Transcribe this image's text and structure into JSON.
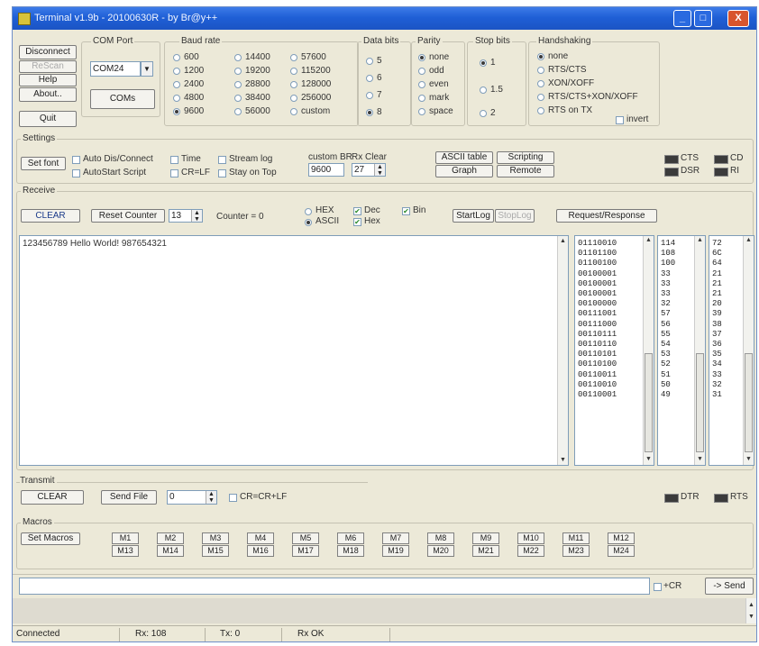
{
  "window": {
    "title": "Terminal v1.9b - 20100630R - by Br@y++",
    "minimize": "_",
    "maximize": "□",
    "close": "X"
  },
  "left_buttons": {
    "disconnect": "Disconnect",
    "rescan": "ReScan",
    "help": "Help",
    "about": "About..",
    "quit": "Quit"
  },
  "com_port": {
    "label": "COM Port",
    "value": "COM24",
    "coms_button": "COMs"
  },
  "baud_rate": {
    "label": "Baud rate",
    "options": [
      "600",
      "1200",
      "2400",
      "4800",
      "9600",
      "14400",
      "19200",
      "28800",
      "38400",
      "56000",
      "57600",
      "115200",
      "128000",
      "256000",
      "custom"
    ],
    "selected": "9600"
  },
  "data_bits": {
    "label": "Data bits",
    "options": [
      "5",
      "6",
      "7",
      "8"
    ],
    "selected": "8"
  },
  "parity": {
    "label": "Parity",
    "options": [
      "none",
      "odd",
      "even",
      "mark",
      "space"
    ],
    "selected": "none"
  },
  "stop_bits": {
    "label": "Stop bits",
    "options": [
      "1",
      "1.5",
      "2"
    ],
    "selected": "1"
  },
  "handshaking": {
    "label": "Handshaking",
    "options": [
      "none",
      "RTS/CTS",
      "XON/XOFF",
      "RTS/CTS+XON/XOFF",
      "RTS on TX"
    ],
    "selected": "none",
    "invert_label": "invert"
  },
  "settings": {
    "label": "Settings",
    "set_font": "Set font",
    "auto_dis_connect": "Auto Dis/Connect",
    "autostart_script": "AutoStart Script",
    "time": "Time",
    "cr_lf": "CR=LF",
    "stream_log": "Stream log",
    "stay_on_top": "Stay on Top",
    "custom_br_label": "custom BR",
    "custom_br_value": "9600",
    "rx_clear_label": "Rx Clear",
    "rx_clear_value": "27",
    "ascii_table": "ASCII table",
    "graph": "Graph",
    "scripting": "Scripting",
    "remote": "Remote",
    "leds": {
      "cts": "CTS",
      "cd": "CD",
      "dsr": "DSR",
      "ri": "RI"
    }
  },
  "receive": {
    "label": "Receive",
    "clear": "CLEAR",
    "reset_counter": "Reset Counter",
    "counter_spin": "13",
    "counter_text": "Counter = 0",
    "hex": "HEX",
    "ascii": "ASCII",
    "dec": "Dec",
    "hex_chk": "Hex",
    "bin": "Bin",
    "startlog": "StartLog",
    "stoplog": "StopLog",
    "request_response": "Request/Response",
    "text": "123456789 Hello World! 987654321",
    "bin_values": [
      "01110010",
      "01101100",
      "01100100",
      "00100001",
      "00100001",
      "00100001",
      "00100000",
      "00111001",
      "00111000",
      "00110111",
      "00110110",
      "00110101",
      "00110100",
      "00110011",
      "00110010",
      "00110001"
    ],
    "dec_values": [
      "114",
      "108",
      "100",
      "33",
      "33",
      "33",
      "32",
      "57",
      "56",
      "55",
      "54",
      "53",
      "52",
      "51",
      "50",
      "49"
    ],
    "hex_values": [
      "72",
      "6C",
      "64",
      "21",
      "21",
      "21",
      "20",
      "39",
      "38",
      "37",
      "36",
      "35",
      "34",
      "33",
      "32",
      "31"
    ]
  },
  "transmit": {
    "label": "Transmit",
    "clear": "CLEAR",
    "send_file": "Send File",
    "spin_value": "0",
    "cr_crlf": "CR=CR+LF",
    "dtr": "DTR",
    "rts": "RTS"
  },
  "macros": {
    "label": "Macros",
    "set_macros": "Set Macros",
    "row1": [
      "M1",
      "M2",
      "M3",
      "M4",
      "M5",
      "M6",
      "M7",
      "M8",
      "M9",
      "M10",
      "M11",
      "M12"
    ],
    "row2": [
      "M13",
      "M14",
      "M15",
      "M16",
      "M17",
      "M18",
      "M19",
      "M20",
      "M21",
      "M22",
      "M23",
      "M24"
    ]
  },
  "send_line": {
    "cr_label": "+CR",
    "send_button": "-> Send"
  },
  "status": {
    "connection": "Connected",
    "rx": "Rx: 108",
    "tx": "Tx: 0",
    "rx_status": "Rx OK"
  }
}
